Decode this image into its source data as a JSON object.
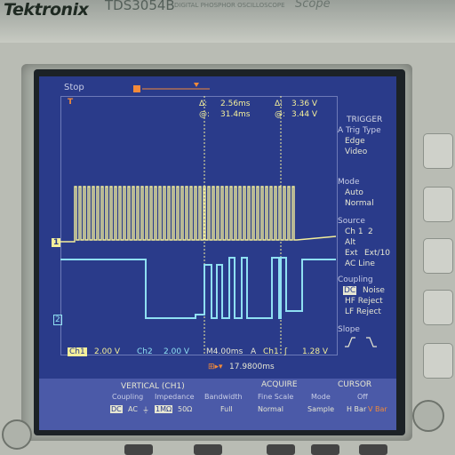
{
  "device": {
    "brand": "Tektronix",
    "model": "TDS3054B",
    "model_desc": "DIGITAL PHOSPHOR OSCILLOSCOPE",
    "scope_label": "Scope"
  },
  "screen": {
    "status": "Stop",
    "cursor": {
      "delta_time": "2.56ms",
      "delta_volt": "3.36 V",
      "at_time": "31.4ms",
      "at_volt": "3.44 V",
      "delta_symbol": "Δ:",
      "at_symbol": "@:"
    },
    "channel_markers": {
      "ch1": "1",
      "ch2": "2",
      "trig_level": "T"
    },
    "scale": {
      "ch1_label": "Ch1",
      "ch1_value": "2.00 V",
      "ch2_label": "Ch2",
      "ch2_value": "2.00 V",
      "time_value": "M4.00ms",
      "trig_mode": "A",
      "trig_source": "Ch1",
      "trig_slope": "ʃ",
      "trig_level": "1.28 V",
      "offset": "17.9800ms"
    },
    "trigger_menu": {
      "title": "TRIGGER",
      "trig_type_label": "A Trig Type",
      "types": [
        "Edge",
        "Video"
      ],
      "mode_label": "Mode",
      "modes": [
        "Auto",
        "Normal"
      ],
      "source_label": "Source",
      "sources": [
        "Ch 1",
        "2",
        "Alt",
        "Ext",
        "Ext/10",
        "AC Line"
      ],
      "coupling_label": "Coupling",
      "couplings": [
        "DC",
        "Noise",
        "HF Reject",
        "LF Reject"
      ],
      "slope_label": "Slope"
    },
    "bottom_menu": {
      "vertical_title": "VERTICAL (CH1)",
      "acquire_title": "ACQUIRE",
      "cursor_title": "CURSOR",
      "row1": [
        "Coupling",
        "Impedance",
        "Bandwidth",
        "Fine Scale",
        "Mode",
        "Off"
      ],
      "row2": [
        "DC",
        "AC",
        "⏚",
        "1MΩ",
        "50Ω",
        "Full",
        "Normal",
        "Sample",
        "H Bar",
        "V Bar"
      ]
    }
  },
  "colors": {
    "screen_bg": "#2a3b8a",
    "ch1_trace": "#f4ef9a",
    "ch2_trace": "#8fe0f2",
    "highlight": "#f28a3a"
  }
}
